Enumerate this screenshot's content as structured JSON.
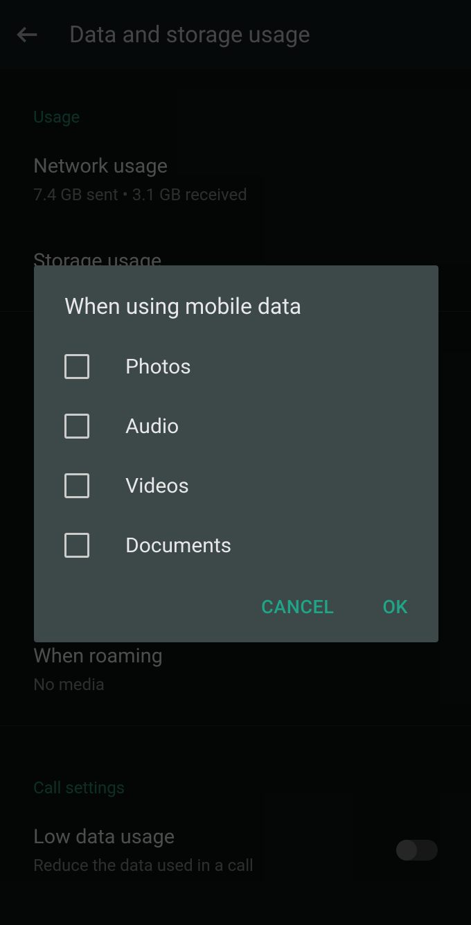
{
  "header": {
    "title": "Data and storage usage"
  },
  "sections": {
    "usage": {
      "label": "Usage",
      "network": {
        "title": "Network usage",
        "subtitle": "7.4 GB sent • 3.1 GB received"
      },
      "storage": {
        "title": "Storage usage"
      }
    },
    "roaming": {
      "title": "When roaming",
      "subtitle": "No media"
    },
    "callSettings": {
      "label": "Call settings",
      "lowData": {
        "title": "Low data usage",
        "subtitle": "Reduce the data used in a call"
      }
    }
  },
  "dialog": {
    "title": "When using mobile data",
    "options": {
      "photos": "Photos",
      "audio": "Audio",
      "videos": "Videos",
      "documents": "Documents"
    },
    "cancel": "CANCEL",
    "ok": "OK"
  }
}
